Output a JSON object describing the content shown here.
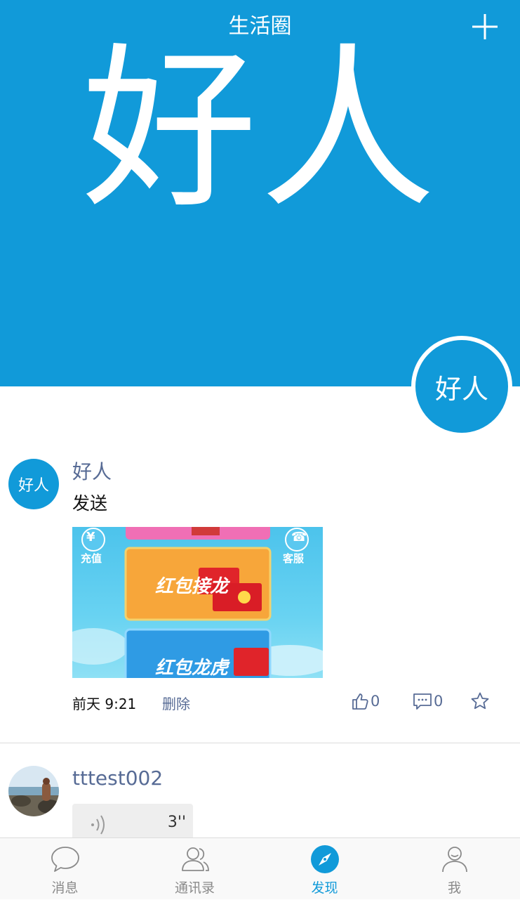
{
  "header": {
    "title": "生活圈",
    "add_icon": "plus-icon",
    "cover_name": "好人",
    "profile_avatar_text": "好人"
  },
  "posts": [
    {
      "author": "好人",
      "avatar_text": "好人",
      "text": "发送",
      "image": {
        "top_left_label": "充值",
        "top_right_label": "客服",
        "card1_label": "红包接龙",
        "card2_label": "红包龙虎"
      },
      "time": "前天 9:21",
      "delete_label": "删除",
      "likes": "0",
      "comments": "0"
    },
    {
      "author": "tttest002",
      "voice_duration": "3''"
    }
  ],
  "tabbar": {
    "items": [
      {
        "label": "消息",
        "icon": "chat-bubble-icon"
      },
      {
        "label": "通讯录",
        "icon": "contacts-icon"
      },
      {
        "label": "发现",
        "icon": "compass-icon"
      },
      {
        "label": "我",
        "icon": "person-icon"
      }
    ],
    "active": 2
  },
  "colors": {
    "accent": "#119ad9",
    "link": "#576b95",
    "inactive": "#8a8a8a"
  }
}
